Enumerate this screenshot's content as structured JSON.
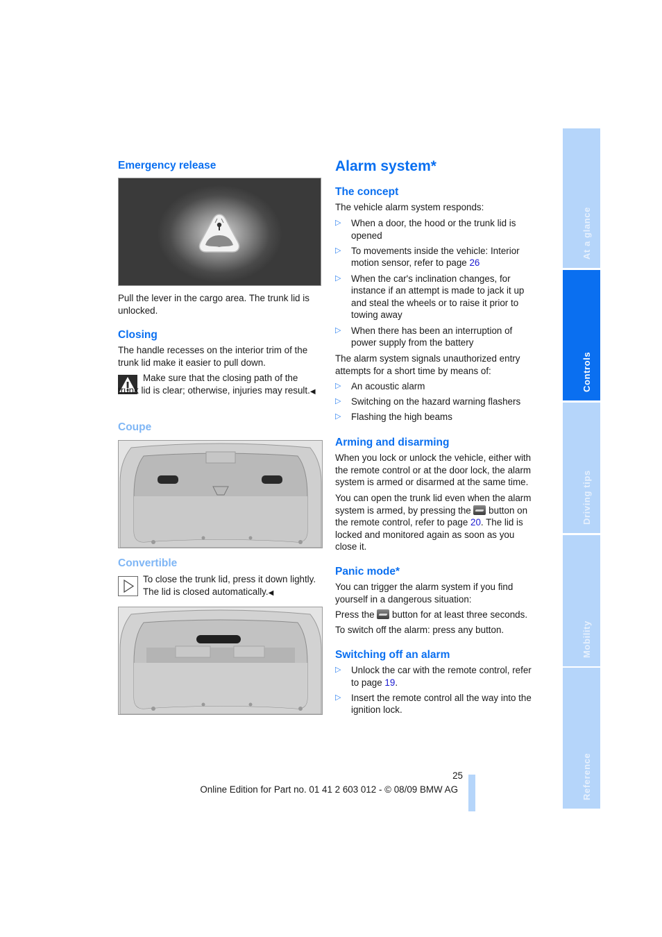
{
  "left": {
    "emergency_heading": "Emergency release",
    "emergency_text": "Pull the lever in the cargo area. The trunk lid is unlocked.",
    "closing_heading": "Closing",
    "closing_text": "The handle recesses on the interior trim of the trunk lid make it easier to pull down.",
    "warning_text": "Make sure that the closing path of the trunk lid is clear; otherwise, injuries may result.",
    "end_mark": "◀",
    "coupe_heading": "Coupe",
    "convertible_heading": "Convertible",
    "convertible_note": "To close the trunk lid, press it down lightly. The lid is closed automatically."
  },
  "right": {
    "title": "Alarm system*",
    "concept_heading": "The concept",
    "concept_intro": "The vehicle alarm system responds:",
    "bullet_glyph": "▷",
    "concept_bullets": [
      {
        "text": "When a door, the hood or the trunk lid is opened"
      },
      {
        "text": "To movements inside the vehicle: Interior motion sensor, refer to page ",
        "link": "26"
      },
      {
        "text": "When the car's inclination changes, for instance if an attempt is made to jack it up and steal the wheels or to raise it prior to towing away"
      },
      {
        "text": "When there has been an interruption of power supply from the battery"
      }
    ],
    "signals_intro": "The alarm system signals unauthorized entry attempts for a short time by means of:",
    "signals_bullets": [
      "An acoustic alarm",
      "Switching on the hazard warning flashers",
      "Flashing the high beams"
    ],
    "arming_heading": "Arming and disarming",
    "arming_p1": "When you lock or unlock the vehicle, either with the remote control or at the door lock, the alarm system is armed or disarmed at the same time.",
    "arming_p2_a": "You can open the trunk lid even when the alarm system is armed, by pressing the ",
    "arming_p2_b": " button on the remote control, refer to page ",
    "arming_p2_link": "20",
    "arming_p2_c": ". The lid is locked and monitored again as soon as you close it.",
    "panic_heading": "Panic mode*",
    "panic_p1": "You can trigger the alarm system if you find yourself in a dangerous situation:",
    "panic_p2_a": "Press the ",
    "panic_p2_b": " button for at least three seconds.",
    "panic_p3": "To switch off the alarm: press any button.",
    "switchoff_heading": "Switching off an alarm",
    "switchoff_b1_text": "Unlock the car with the remote control, refer to page ",
    "switchoff_b1_link": "19",
    "switchoff_b1_end": ".",
    "switchoff_b2_text": "Insert the remote control all the way into the ignition lock."
  },
  "tabs": [
    {
      "label": "At a glance",
      "active": false
    },
    {
      "label": "Controls",
      "active": true
    },
    {
      "label": "Driving tips",
      "active": false
    },
    {
      "label": "Mobility",
      "active": false
    },
    {
      "label": "Reference",
      "active": false
    }
  ],
  "footer": {
    "page_number": "25",
    "edition": "Online Edition for Part no. 01 41 2 603 012 - © 08/09 BMW AG"
  },
  "colors": {
    "heading_blue": "#0a6ff0",
    "subheading_light_blue": "#7fb6f5",
    "tab_active": "#0a6ff0",
    "tab_inactive": "#b5d5fa",
    "link": "#1a1ad0"
  }
}
